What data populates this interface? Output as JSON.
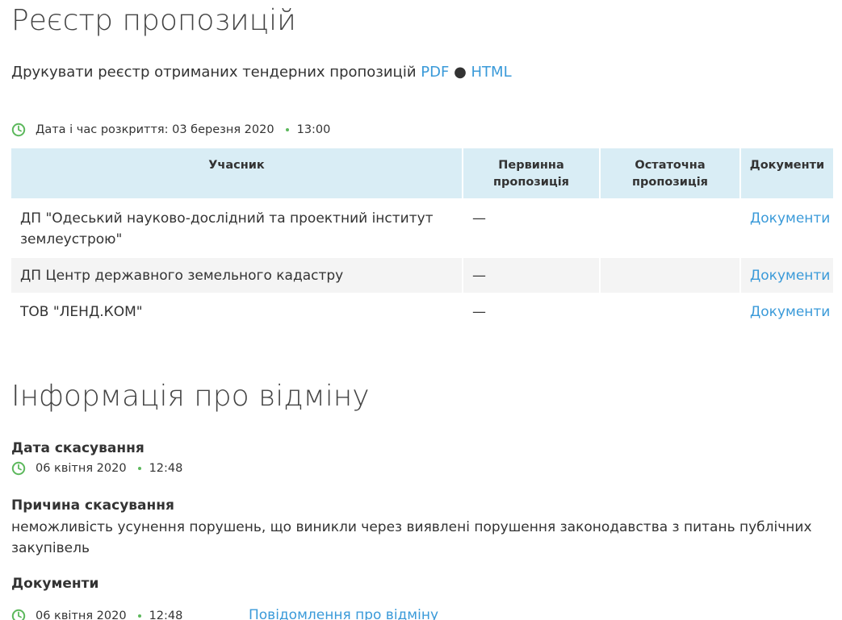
{
  "registry": {
    "title": "Реєстр пропозицій",
    "print_text": "Друкувати реєстр отриманих тендерних пропозицій",
    "pdf_link": "PDF",
    "separator": "●",
    "html_link": "HTML",
    "opening_label": "Дата і час розкриття: 03 березня 2020",
    "opening_time": "13:00",
    "table": {
      "headers": [
        "Учасник",
        "Первинна пропозиція",
        "Остаточна пропозиція",
        "Документи"
      ],
      "rows": [
        {
          "participant": "ДП \"Одеський науково-дослідний та проектний інститут землеустрою\"",
          "initial": "—",
          "final": "",
          "docs": "Документи"
        },
        {
          "participant": "ДП Центр державного земельного кадастру",
          "initial": "—",
          "final": "",
          "docs": "Документи"
        },
        {
          "participant": "ТОВ \"ЛЕНД.КОМ\"",
          "initial": "—",
          "final": "",
          "docs": "Документи"
        }
      ]
    }
  },
  "cancellation": {
    "title": "Інформація про відміну",
    "date_label": "Дата скасування",
    "date": "06 квітня 2020",
    "time": "12:48",
    "reason_label": "Причина скасування",
    "reason": "неможливість усунення порушень, що виникли через виявлені порушення законодавства з питань публічних закупівель",
    "documents_label": "Документи",
    "doc_date": "06 квітня 2020",
    "doc_time": "12:48",
    "doc_link": "Повідомлення про відміну"
  },
  "colors": {
    "link": "#3a9ad9",
    "header_bg": "#d9edf5",
    "stripe_bg": "#f4f4f4",
    "clock_icon": "#5cb85c"
  },
  "icons": {
    "clock": "clock-icon"
  }
}
